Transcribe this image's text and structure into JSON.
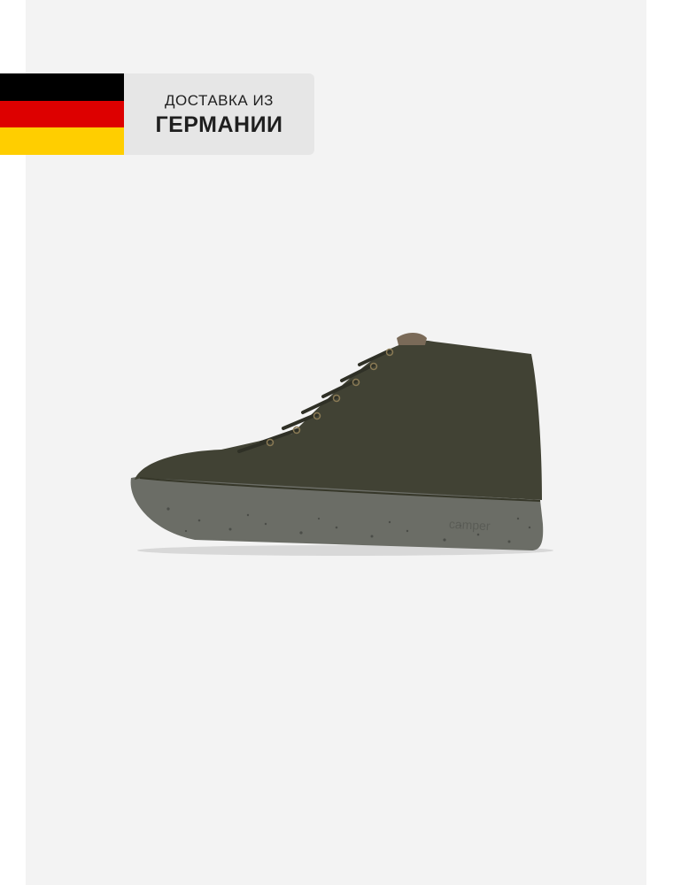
{
  "banner": {
    "line1": "ДОСТАВКА ИЗ",
    "line2": "ГЕРМАНИИ",
    "flag_colors": [
      "#000000",
      "#dd0000",
      "#ffce00"
    ]
  },
  "product": {
    "image": "shoe-illustration",
    "sole_text": "camper"
  },
  "colors": {
    "backdrop": "#f3f3f3",
    "upper": "#414234",
    "sole": "#6b6d66"
  }
}
